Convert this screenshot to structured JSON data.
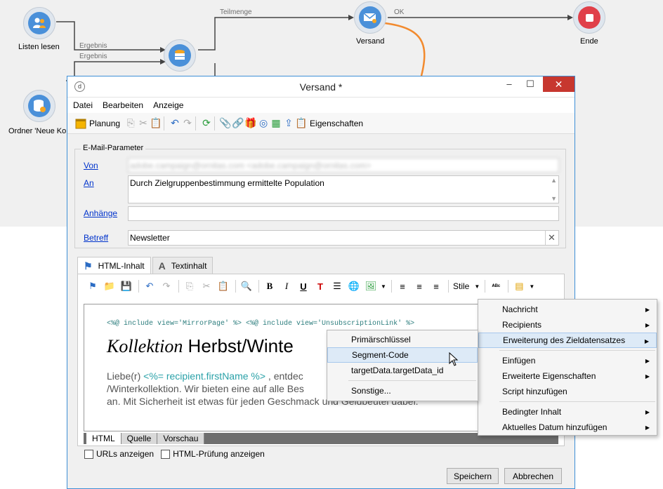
{
  "workflow": {
    "nodes": {
      "listen_lesen": "Listen lesen",
      "ordner": "Ordner 'Neue Kor",
      "versand": "Versand",
      "ende": "Ende"
    },
    "edges": {
      "ergebnis_1": "Ergebnis",
      "ergebnis_2": "Ergebnis",
      "teilmenge": "Teilmenge",
      "ok": "OK"
    },
    "colors": {
      "node_accent": "#4a90d9",
      "end_accent": "#e0404a",
      "connector": "#f28a2e"
    }
  },
  "dialog": {
    "title": "Versand *",
    "menu": [
      "Datei",
      "Bearbeiten",
      "Anzeige"
    ],
    "toolbar": {
      "planung": "Planung",
      "eigenschaften": "Eigenschaften"
    },
    "params": {
      "legend": "E-Mail-Parameter",
      "von_label": "Von",
      "von_value": "adobe.campaign@ornitas.com <adobe.campaign@ornitas.com>",
      "an_label": "An",
      "an_value": "Durch Zielgruppenbestimmung ermittelte Population",
      "anhaenge_label": "Anhänge",
      "betreff_label": "Betreff",
      "betreff_value": "Newsletter"
    },
    "tabs": {
      "html": "HTML-Inhalt",
      "text": "Textinhalt"
    },
    "editor_toolbar": {
      "stile": "Stile"
    },
    "editor": {
      "code_line": "<%@ include view='MirrorPage' %> <%@ include view='UnsubscriptionLink' %>",
      "headline_italic": "Kollektion",
      "headline_rest": " Herbst/Winte",
      "body_1": "Liebe(r) ",
      "body_tpl": "<%= recipient.firstName %>",
      "body_2": " , entdec",
      "body_3": "/Winterkollektion. Wir bieten eine auf alle Bes",
      "body_4": "an. Mit Sicherheit ist etwas für jeden Geschmack und Geldbeutel dabei."
    },
    "view_tabs": [
      "HTML",
      "Quelle",
      "Vorschau"
    ],
    "checks": {
      "urls": "URLs anzeigen",
      "html_check": "HTML-Prüfung anzeigen"
    },
    "buttons": {
      "save": "Speichern",
      "cancel": "Abbrechen"
    }
  },
  "context_menu_main": [
    {
      "label": "Nachricht",
      "submenu": true
    },
    {
      "label": "Recipients",
      "submenu": true
    },
    {
      "label": "Erweiterung des Zieldatensatzes",
      "submenu": true,
      "highlighted": true
    },
    {
      "label": "Einfügen",
      "submenu": true
    },
    {
      "label": "Erweiterte Eigenschaften",
      "submenu": true
    },
    {
      "label": "Script hinzufügen",
      "submenu": false
    },
    {
      "label": "Bedingter Inhalt",
      "submenu": true
    },
    {
      "label": "Aktuelles Datum hinzufügen",
      "submenu": true
    }
  ],
  "context_menu_sub": [
    {
      "label": "Primärschlüssel"
    },
    {
      "label": "Segment-Code",
      "highlighted": true
    },
    {
      "label": "targetData.targetData_id"
    },
    {
      "label": "Sonstige..."
    }
  ]
}
